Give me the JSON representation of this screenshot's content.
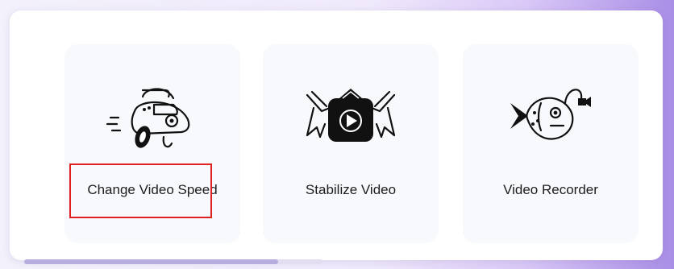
{
  "cards": [
    {
      "label": "Change Video Speed",
      "icon": "speed-car-icon"
    },
    {
      "label": "Stabilize Video",
      "icon": "stabilize-icon"
    },
    {
      "label": "Video Recorder",
      "icon": "recorder-fish-icon"
    }
  ],
  "progress": {
    "fraction": 0.85
  },
  "highlight_color": "#e02020"
}
